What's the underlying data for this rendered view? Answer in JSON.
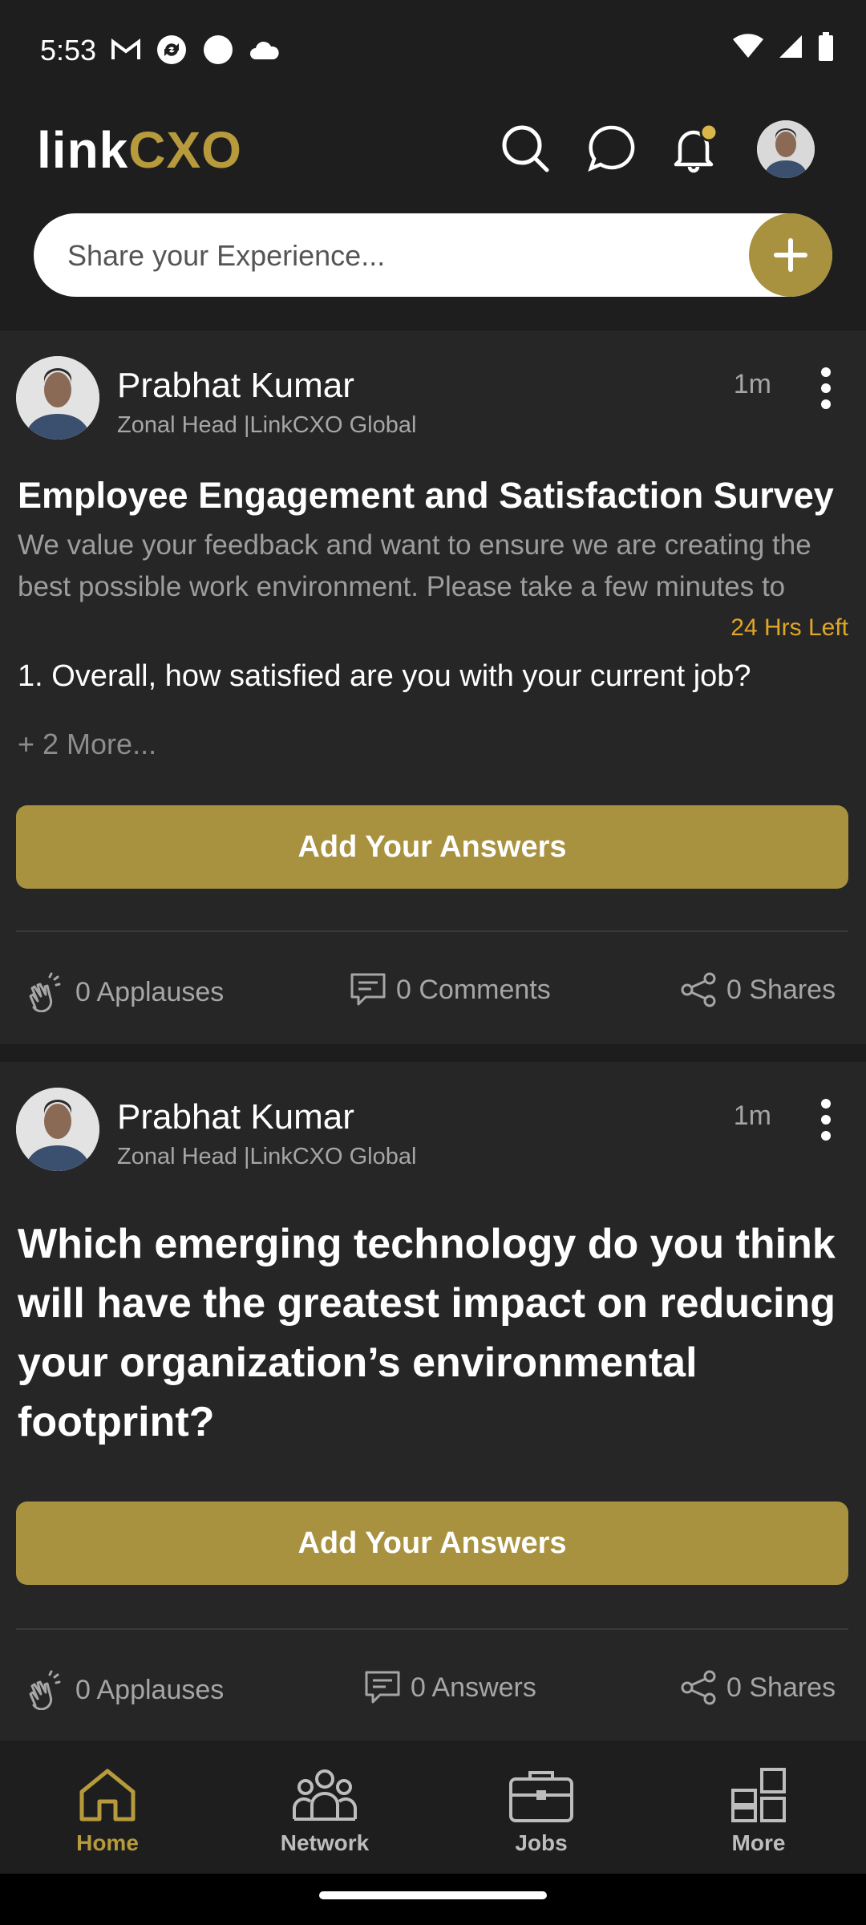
{
  "status_bar": {
    "time": "5:53",
    "left_icons": [
      "gmail-icon",
      "sync-icon",
      "circle-icon",
      "cloud-icon"
    ],
    "right_icons": [
      "wifi-icon",
      "signal-icon",
      "battery-icon"
    ]
  },
  "header": {
    "logo_prefix": "link",
    "logo_suffix": "CXO",
    "icons": [
      "search-icon",
      "chat-icon",
      "bell-icon",
      "avatar"
    ],
    "notification_dot_color": "#d9b54a",
    "share_placeholder": "Share your Experience..."
  },
  "colors": {
    "accent": "#a8923f",
    "logo_gold": "#b69a3c",
    "timer_orange": "#e0a626",
    "background": "#1d1d1d",
    "card": "#262626"
  },
  "posts": [
    {
      "author": "Prabhat Kumar",
      "role": "Zonal Head |LinkCXO Global",
      "time": "1m",
      "title": "Employee Engagement and Satisfaction Survey",
      "description": "We value your feedback and want to ensure we are creating the best possible work environment. Please take a few minutes to complete this survey.",
      "time_left": "24 Hrs Left",
      "question": "1. Overall, how satisfied are you with your current job?",
      "more": "+ 2 More...",
      "button": "Add Your Answers",
      "applauses": "0 Applauses",
      "comments": "0 Comments",
      "shares": "0 Shares"
    },
    {
      "author": "Prabhat Kumar",
      "role": "Zonal Head |LinkCXO Global",
      "time": "1m",
      "question": "Which emerging technology do you think will have the greatest impact on reducing your organization’s environmental footprint?",
      "button": "Add Your Answers",
      "applauses": "0 Applauses",
      "answers": "0 Answers",
      "shares": "0 Shares"
    }
  ],
  "bottom_nav": [
    {
      "label": "Home",
      "icon": "home-icon",
      "active": true
    },
    {
      "label": "Network",
      "icon": "network-icon",
      "active": false
    },
    {
      "label": "Jobs",
      "icon": "briefcase-icon",
      "active": false
    },
    {
      "label": "More",
      "icon": "grid-icon",
      "active": false
    }
  ]
}
